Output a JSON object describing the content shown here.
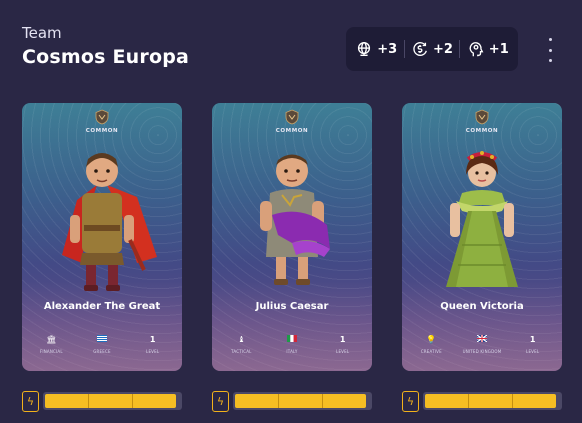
{
  "header": {
    "label": "Team",
    "name": "Cosmos Europa"
  },
  "stats": [
    {
      "icon": "globe-icon",
      "value": "+3"
    },
    {
      "icon": "coin-swirl-icon",
      "value": "+2"
    },
    {
      "icon": "head-profile-icon",
      "value": "+1"
    }
  ],
  "cards": [
    {
      "rarity": "COMMON",
      "name": "Alexander The Great",
      "attrs": [
        {
          "icon": "bank-icon",
          "value": "",
          "label": "FINANCIAL"
        },
        {
          "icon": "flag-icon",
          "value": "",
          "label": "GREECE"
        },
        {
          "icon": "",
          "value": "1",
          "label": "LEVEL"
        }
      ],
      "energy": 0.97
    },
    {
      "rarity": "COMMON",
      "name": "Julius Caesar",
      "attrs": [
        {
          "icon": "chess-piece-icon",
          "value": "",
          "label": "TACTICAL"
        },
        {
          "icon": "flag-icon",
          "value": "",
          "label": "ITALY"
        },
        {
          "icon": "",
          "value": "1",
          "label": "LEVEL"
        }
      ],
      "energy": 0.97
    },
    {
      "rarity": "COMMON",
      "name": "Queen Victoria",
      "attrs": [
        {
          "icon": "lightbulb-icon",
          "value": "",
          "label": "CREATIVE"
        },
        {
          "icon": "flag-icon",
          "value": "",
          "label": "UNITED KINGDOM"
        },
        {
          "icon": "",
          "value": "1",
          "label": "LEVEL"
        }
      ],
      "energy": 0.97
    }
  ],
  "colors": {
    "background": "#2a2745",
    "accent": "#f6be23",
    "panel": "#1e1c36"
  }
}
